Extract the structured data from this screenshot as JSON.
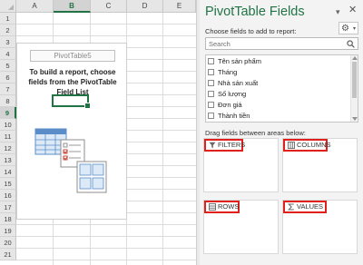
{
  "spreadsheet": {
    "columns": [
      "A",
      "B",
      "C",
      "D",
      "E"
    ],
    "selected_column": "B",
    "rows": [
      "1",
      "2",
      "3",
      "4",
      "5",
      "6",
      "7",
      "8",
      "9",
      "10",
      "11",
      "12",
      "13",
      "14",
      "15",
      "16",
      "17",
      "18",
      "19",
      "20",
      "21"
    ],
    "selected_row": "9",
    "pivot": {
      "name": "PivotTable5",
      "message": "To build a report, choose fields from the PivotTable Field List"
    }
  },
  "pane": {
    "title": "PivotTable Fields",
    "choose_label": "Choose fields to add to report:",
    "search_placeholder": "Search",
    "fields": [
      "Tên sản phẩm",
      "Tháng",
      "Nhà sản xuất",
      "Số lượng",
      "Đơn giá",
      "Thành tiền"
    ],
    "drag_label": "Drag fields between areas below:",
    "areas": {
      "filters": "FILTERS",
      "columns": "COLUMNS",
      "rows": "ROWS",
      "values": "VALUES"
    },
    "accent_color": "#217346",
    "highlight_color": "#e0201b"
  }
}
